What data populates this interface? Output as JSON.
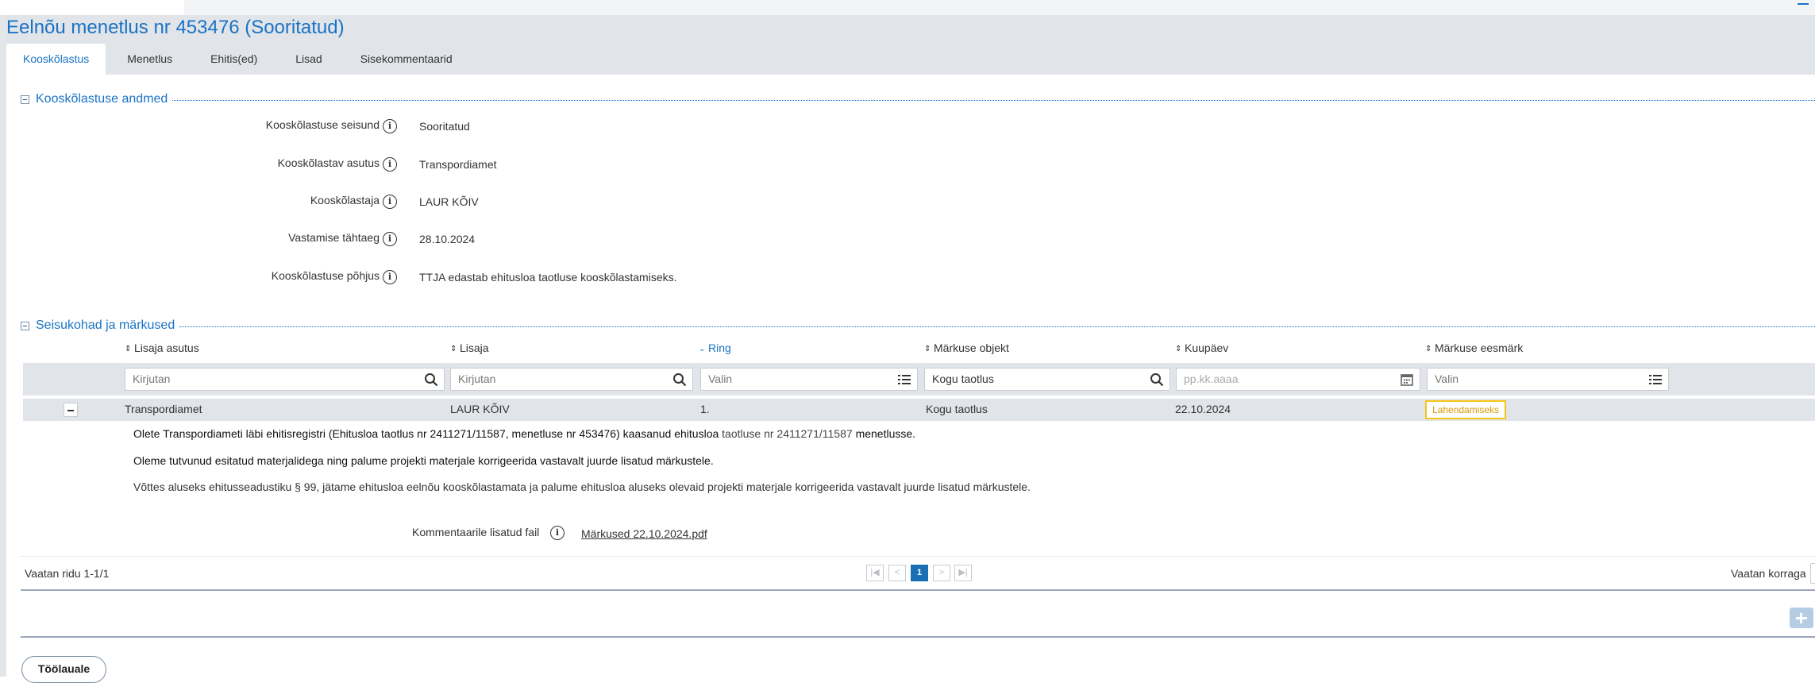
{
  "header": {
    "title": "Eelnõu menetlus nr 453476 (Sooritatud)"
  },
  "tabs": [
    {
      "label": "Kooskõlastus",
      "active": true
    },
    {
      "label": "Menetlus"
    },
    {
      "label": "Ehitis(ed)"
    },
    {
      "label": "Lisad"
    },
    {
      "label": "Sisekommentaarid"
    }
  ],
  "details": {
    "title": "Kooskõlastuse andmed",
    "fields": [
      {
        "label": "Kooskõlastuse seisund",
        "value": "Sooritatud"
      },
      {
        "label": "Kooskõlastav asutus",
        "value": "Transpordiamet"
      },
      {
        "label": "Kooskõlastaja",
        "value": "LAUR KÕIV"
      },
      {
        "label": "Vastamise tähtaeg",
        "value": "28.10.2024"
      },
      {
        "label": "Kooskõlastuse põhjus",
        "value": "TTJA edastab ehitusloa taotluse kooskõlastamiseks."
      }
    ]
  },
  "remarks": {
    "title": "Seisukohad ja märkused",
    "columns": [
      "Lisaja asutus",
      "Lisaja",
      "Ring",
      "Märkuse objekt",
      "Kuupäev",
      "Märkuse eesmärk"
    ],
    "filters": [
      "Kirjutan",
      "Kirjutan",
      "Valin",
      "Kogu taotlus",
      "pp.kk.aaaa",
      "Valin"
    ],
    "rows": [
      {
        "agency": "Transpordiamet",
        "author": "LAUR KÕIV",
        "round": "1.",
        "object": "Kogu taotlus",
        "date": "22.10.2024",
        "purpose": "Lahendamiseks",
        "comment_p1_a": "Olete Transpordiameti läbi ehitisregistri (Ehitusloa taotlus nr 2411271/11587, menetluse nr 453476) kaasanud ehitusloa",
        "comment_p1_b": "taotluse nr 2411271/11587",
        "comment_p1_c": "menetlusse.",
        "comment_p2": "Oleme tutvunud esitatud materjalidega ning palume projekti materjale korrigeerida vastavalt juurde lisatud märkustele.",
        "comment_p3": "Võttes aluseks ehitusseadustiku § 99, jätame ehitusloa eelnõu kooskõlastamata ja palume ehitusloa aluseks olevaid projekti materjale korrigeerida vastavalt juurde lisatud märkustele.",
        "attachment_label": "Kommentaarile lisatud fail",
        "attachment": "Märkused 22.10.2024.pdf"
      }
    ],
    "paginator": {
      "summary": "Vaatan ridu 1-1/1",
      "current_page": "1",
      "per_page_label": "Vaatan korraga"
    }
  },
  "footer": {
    "worklist_button": "Töölauale"
  },
  "colors": {
    "accent": "#1a73c5",
    "header_bg": "#e1e4e8",
    "badge_border": "#f5c518",
    "page_active": "#1a6fb5"
  },
  "icons": [
    "info-icon",
    "search-icon",
    "list-icon",
    "calendar-icon",
    "sort-icon",
    "collapse-icon",
    "add-icon"
  ]
}
